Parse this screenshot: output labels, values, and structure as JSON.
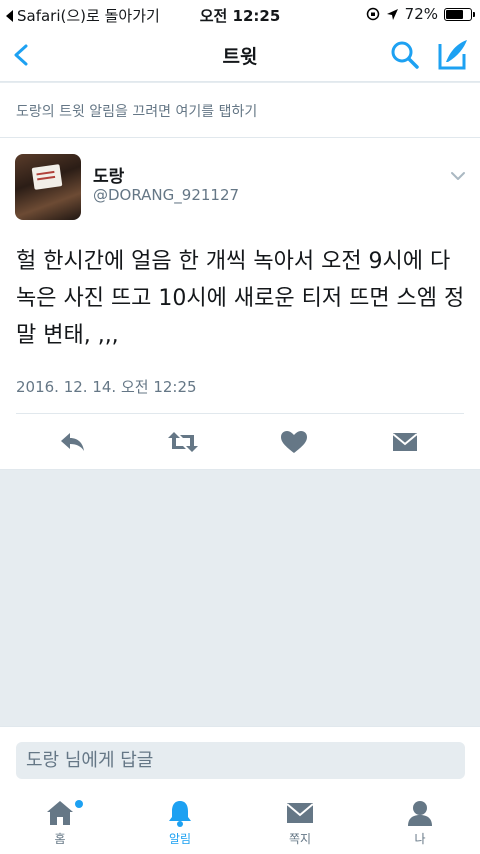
{
  "status_bar": {
    "back_app": "Safari(으)로 돌아가기",
    "time": "오전 12:25",
    "battery": "72%",
    "battery_level": 0.72
  },
  "navbar": {
    "title": "트윗"
  },
  "notice": "도랑의 트윗 알림을 끄려면 여기를 탭하기",
  "tweet": {
    "author_name": "도랑",
    "author_handle": "@DORANG_921127",
    "text": "헐 한시간에 얼음 한 개씩 녹아서 오전 9시에 다 녹은 사진 뜨고 10시에 새로운 티저 뜨면 스엠 정말 변태, ,,,",
    "timestamp": "2016. 12. 14. 오전 12:25"
  },
  "reply": {
    "placeholder": "도랑 님에게 답글"
  },
  "tabs": [
    {
      "label": "홈",
      "icon": "home-icon",
      "active": false,
      "has_dot": true
    },
    {
      "label": "알림",
      "icon": "bell-icon",
      "active": true,
      "has_dot": false
    },
    {
      "label": "쪽지",
      "icon": "envelope-icon",
      "active": false,
      "has_dot": false
    },
    {
      "label": "나",
      "icon": "person-icon",
      "active": false,
      "has_dot": false
    }
  ],
  "colors": {
    "accent": "#1da1f2",
    "icon_gray": "#657786",
    "background": "#e6ecf0"
  }
}
